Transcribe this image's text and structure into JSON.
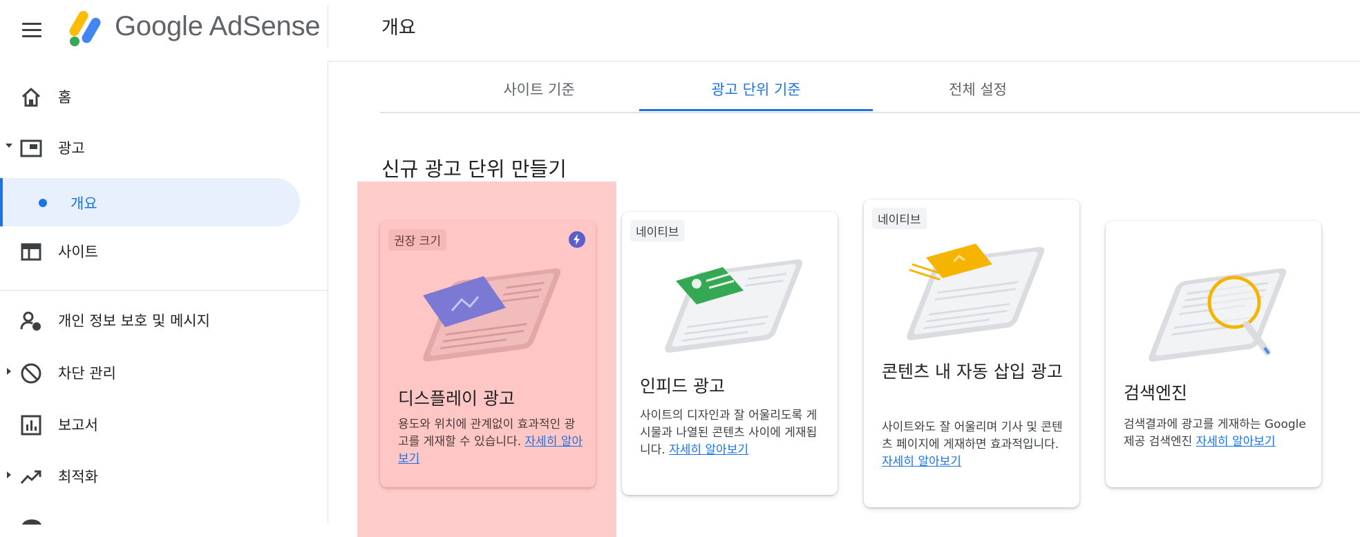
{
  "header": {
    "brand": "Google AdSense",
    "page_title": "개요"
  },
  "sidebar": {
    "items": [
      {
        "label": "홈",
        "icon": "home-icon"
      },
      {
        "label": "광고",
        "icon": "ads-icon"
      },
      {
        "label": "개요",
        "icon": "dot-icon"
      },
      {
        "label": "사이트",
        "icon": "sites-icon"
      },
      {
        "label": "개인 정보 보호 및 메시지",
        "icon": "privacy-messaging-icon"
      },
      {
        "label": "차단 관리",
        "icon": "block-icon"
      },
      {
        "label": "보고서",
        "icon": "reports-icon"
      },
      {
        "label": "최적화",
        "icon": "optimization-icon"
      }
    ]
  },
  "tabs": [
    {
      "label": "사이트 기준"
    },
    {
      "label": "광고 단위 기준"
    },
    {
      "label": "전체 설정"
    }
  ],
  "active_tab": "광고 단위 기준",
  "section_title": "신규 광고 단위 만들기",
  "cards": [
    {
      "chip": "권장 크기",
      "title": "디스플레이 광고",
      "desc": "용도와 위치에 관계없이 효과적인 광고를 게재할 수 있습니다. ",
      "link": "자세히 알아보기"
    },
    {
      "chip": "네이티브",
      "title": "인피드 광고",
      "desc": "사이트의 디자인과 잘 어울리도록 게시물과 나열된 콘텐츠 사이에 게재됩니다. ",
      "link": "자세히 알아보기"
    },
    {
      "chip": "네이티브",
      "title": "콘텐츠 내 자동 삽입 광고",
      "desc": "사이트와도 잘 어울리며 기사 및 콘텐츠 페이지에 게재하면 효과적입니다. ",
      "link": "자세히 알아보기"
    },
    {
      "chip": "",
      "title": "검색엔진",
      "desc": "검색결과에 광고를 게재하는 Google 제공 검색엔진 ",
      "link": "자세히 알아보기"
    }
  ],
  "colors": {
    "accent": "#1a73e8",
    "highlight": "#ffcccc",
    "display_ad": "#7b79d3",
    "in_feed": "#34a853",
    "in_article": "#f4b400",
    "search": "#f4b400"
  }
}
